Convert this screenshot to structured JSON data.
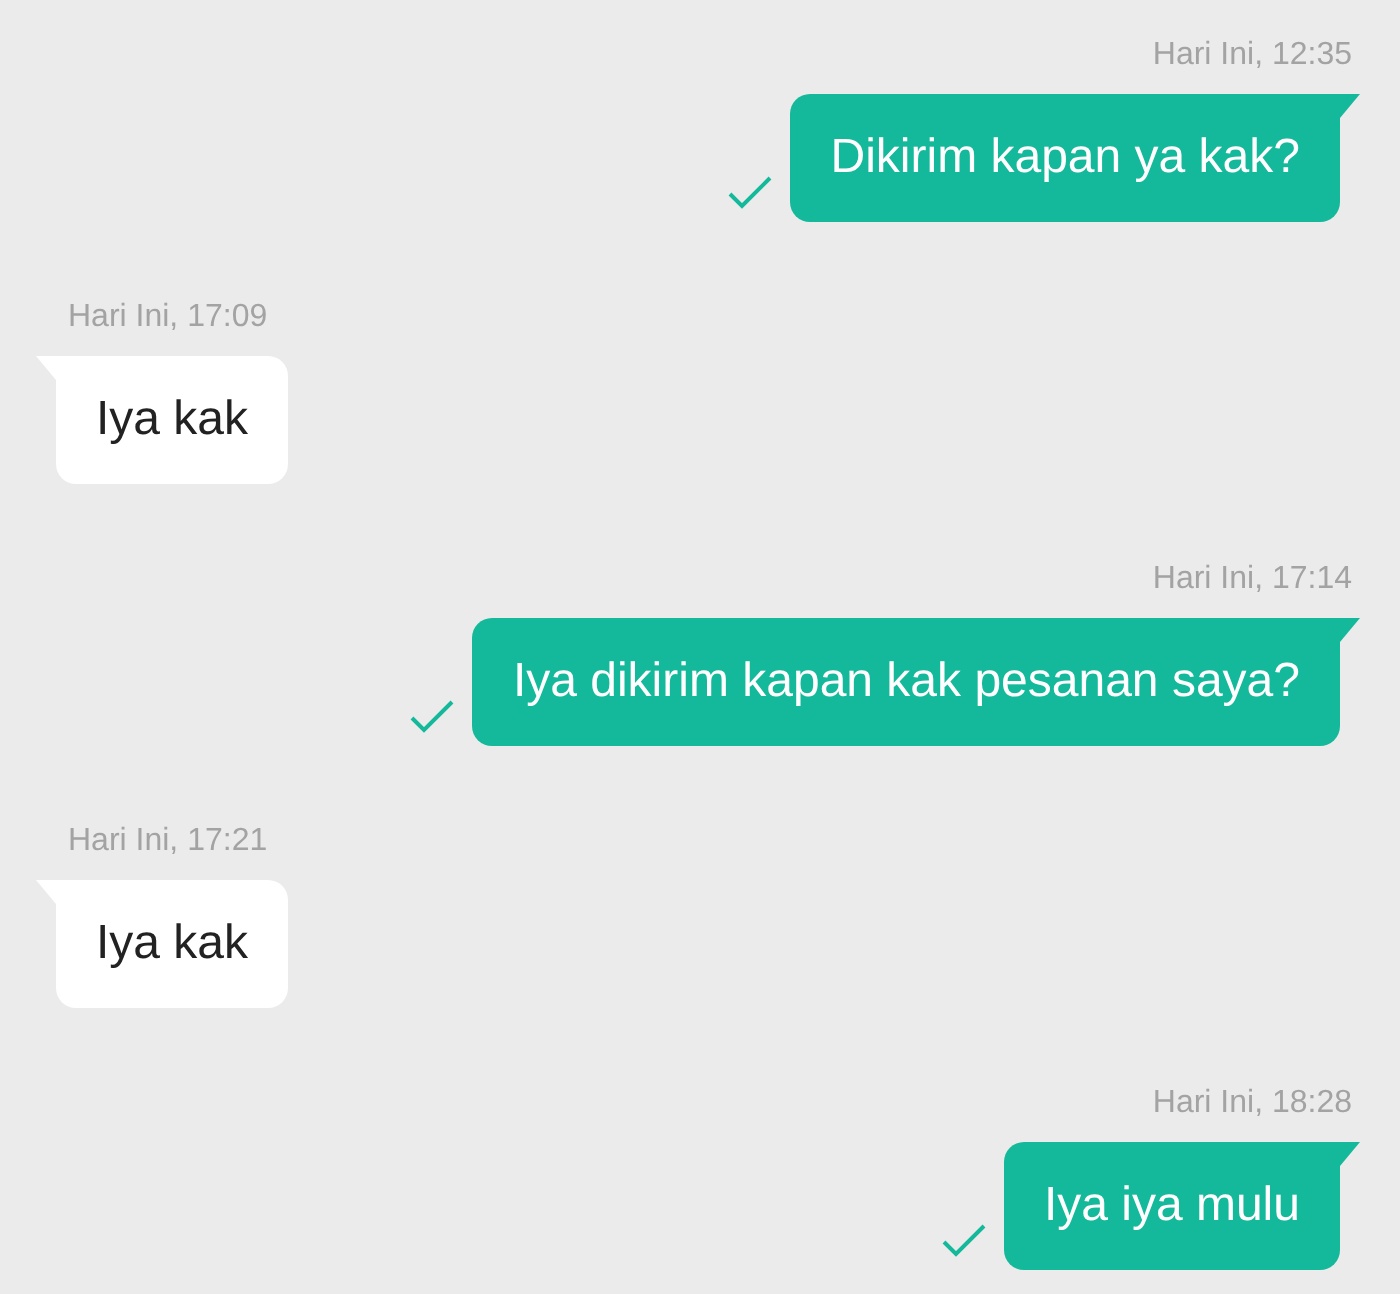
{
  "messages": [
    {
      "kind": "sent",
      "time": "Hari Ini, 12:35",
      "text": "Dikirim kapan ya kak?",
      "delivered": true
    },
    {
      "kind": "received",
      "time": "Hari Ini, 17:09",
      "text": "Iya kak"
    },
    {
      "kind": "sent",
      "time": "Hari Ini, 17:14",
      "text": "Iya dikirim kapan kak pesanan saya?",
      "delivered": true
    },
    {
      "kind": "received",
      "time": "Hari Ini, 17:21",
      "text": "Iya kak"
    },
    {
      "kind": "sent",
      "time": "Hari Ini, 18:28",
      "text": "Iya iya mulu",
      "delivered": true
    }
  ]
}
